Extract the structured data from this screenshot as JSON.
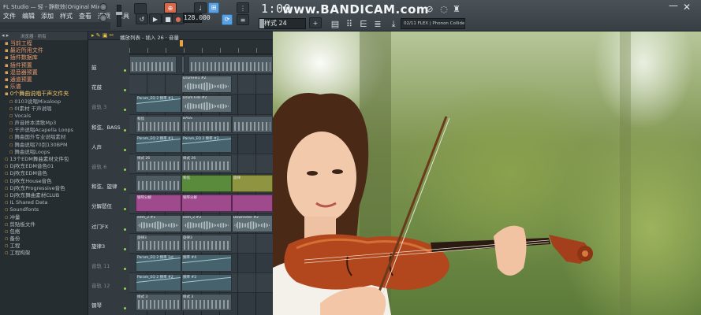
{
  "window": {
    "title": "FL Studio — 轻 - 静默效(Original Mix)"
  },
  "menu": [
    "文件",
    "编辑",
    "添加",
    "样式",
    "查看",
    "选项",
    "工具",
    "帮助"
  ],
  "transport": {
    "tempo": "128.000",
    "time": "1:00",
    "watermark": "www.BANDICAM.com",
    "pattern": "样式 24",
    "plugin": "02/11 FLEX | Phonon Collider"
  },
  "browser": {
    "header": "浏览器 · 所有",
    "items": [
      {
        "label": "当前工程",
        "kind": "top"
      },
      {
        "label": "最近所用文件",
        "kind": "top"
      },
      {
        "label": "插件数据库",
        "kind": "top"
      },
      {
        "label": "插件预置",
        "kind": "top"
      },
      {
        "label": "混音器预置",
        "kind": "top"
      },
      {
        "label": "通道预置",
        "kind": "top"
      },
      {
        "label": "乐谱",
        "kind": "top"
      },
      {
        "label": "0个舞曲说唱干声文件夹",
        "kind": "hl"
      },
      {
        "label": "0103说唱Mixaloop",
        "kind": "sub"
      },
      {
        "label": "0I素材 干声说唱",
        "kind": "sub"
      },
      {
        "label": "Vocals",
        "kind": "sub"
      },
      {
        "label": "声音样本清歌Mp3",
        "kind": "sub"
      },
      {
        "label": "干声说唱Acapella Loops",
        "kind": "sub"
      },
      {
        "label": "舞曲国外专业说唱素材",
        "kind": "sub"
      },
      {
        "label": "舞曲说唱70到130BPM",
        "kind": "sub"
      },
      {
        "label": "舞曲说唱Loops",
        "kind": "sub"
      },
      {
        "label": "13个EDM舞曲素材文件包",
        "kind": "lvl0"
      },
      {
        "label": "Dj吹东EDM音色01",
        "kind": "lvl0"
      },
      {
        "label": "Dj吹东EDM音色",
        "kind": "lvl0"
      },
      {
        "label": "Dj吹东House音色",
        "kind": "lvl0"
      },
      {
        "label": "Dj吹东Progressive音色",
        "kind": "lvl0"
      },
      {
        "label": "Dj吹东舞曲素材CLUB",
        "kind": "lvl0"
      },
      {
        "label": "IL Shared Data",
        "kind": "lvl0"
      },
      {
        "label": "Soundfonts",
        "kind": "lvl0"
      },
      {
        "label": "冲量",
        "kind": "lvl0"
      },
      {
        "label": "剪贴板文件",
        "kind": "lvl0"
      },
      {
        "label": "包络",
        "kind": "lvl0"
      },
      {
        "label": "备份",
        "kind": "lvl0"
      },
      {
        "label": "工程",
        "kind": "lvl0"
      },
      {
        "label": "工程构架",
        "kind": "lvl0"
      }
    ]
  },
  "playlist": {
    "header": "播放列表 - 插入 26 · 音量",
    "tracks": [
      {
        "label": "鼓",
        "dim": false
      },
      {
        "label": "花鼓",
        "dim": false
      },
      {
        "label": "音轨 3",
        "dim": true
      },
      {
        "label": "和弦、BASS",
        "dim": false
      },
      {
        "label": "人声",
        "dim": false
      },
      {
        "label": "音轨 6",
        "dim": true
      },
      {
        "label": "和弦、旋律",
        "dim": false
      },
      {
        "label": "分解琶伍",
        "dim": false
      },
      {
        "label": "过门FX",
        "dim": false
      },
      {
        "label": "旋律3",
        "dim": false
      },
      {
        "label": "音轨 11",
        "dim": true
      },
      {
        "label": "音轨 12",
        "dim": true
      },
      {
        "label": "钢琴",
        "dim": false
      }
    ],
    "clips": [
      {
        "row": 0,
        "start": 0,
        "len": 60,
        "kind": "pat",
        "label": ""
      },
      {
        "row": 0,
        "start": 66,
        "len": 4,
        "kind": "pat",
        "label": ""
      },
      {
        "row": 0,
        "start": 75,
        "len": 107,
        "kind": "pat",
        "label": ""
      },
      {
        "row": 1,
        "start": 66,
        "len": 64,
        "kind": "aud",
        "label": "DrumFill1 #2"
      },
      {
        "row": 2,
        "start": 8,
        "len": 58,
        "kind": "auto",
        "label": "Param_EQ 2 频率 #1"
      },
      {
        "row": 2,
        "start": 66,
        "len": 64,
        "kind": "aud",
        "label": "Drum Fills #2"
      },
      {
        "row": 3,
        "start": 8,
        "len": 58,
        "kind": "pat",
        "label": "和弦"
      },
      {
        "row": 3,
        "start": 66,
        "len": 64,
        "kind": "pat",
        "label": "BASS"
      },
      {
        "row": 3,
        "start": 130,
        "len": 52,
        "kind": "pat",
        "label": ""
      },
      {
        "row": 4,
        "start": 8,
        "len": 58,
        "kind": "auto",
        "label": "Param_EQ 2 频率 #1"
      },
      {
        "row": 4,
        "start": 66,
        "len": 64,
        "kind": "auto",
        "label": "Param_EQ 2 频率 #2"
      },
      {
        "row": 5,
        "start": 8,
        "len": 58,
        "kind": "pat",
        "label": "样式 26"
      },
      {
        "row": 5,
        "start": 66,
        "len": 64,
        "kind": "pat",
        "label": "样式 26"
      },
      {
        "row": 6,
        "start": 8,
        "len": 58,
        "kind": "pat",
        "label": ""
      },
      {
        "row": 6,
        "start": 66,
        "len": 64,
        "kind": "green",
        "label": "和弦"
      },
      {
        "row": 6,
        "start": 130,
        "len": 52,
        "kind": "yellow",
        "label": "旋律"
      },
      {
        "row": 7,
        "start": 8,
        "len": 58,
        "kind": "pink",
        "label": "钢琴分解"
      },
      {
        "row": 7,
        "start": 66,
        "len": 64,
        "kind": "pink",
        "label": "钢琴分解"
      },
      {
        "row": 7,
        "start": 130,
        "len": 52,
        "kind": "pink",
        "label": ""
      },
      {
        "row": 8,
        "start": 8,
        "len": 58,
        "kind": "aud",
        "label": "edm_2 #1"
      },
      {
        "row": 8,
        "start": 66,
        "len": 64,
        "kind": "aud",
        "label": "edm_2 #2"
      },
      {
        "row": 8,
        "start": 130,
        "len": 52,
        "kind": "aud",
        "label": "DownFilter #2"
      },
      {
        "row": 9,
        "start": 8,
        "len": 58,
        "kind": "pat",
        "label": "旋律3"
      },
      {
        "row": 9,
        "start": 66,
        "len": 64,
        "kind": "pat",
        "label": "旋律3"
      },
      {
        "row": 10,
        "start": 8,
        "len": 58,
        "kind": "auto",
        "label": "Param_EQ 2 频率 1st"
      },
      {
        "row": 10,
        "start": 66,
        "len": 64,
        "kind": "auto",
        "label": "频率 #4"
      },
      {
        "row": 11,
        "start": 8,
        "len": 58,
        "kind": "auto",
        "label": "Param_EQ 2 频率 #2"
      },
      {
        "row": 11,
        "start": 66,
        "len": 64,
        "kind": "auto",
        "label": "频率 #2"
      },
      {
        "row": 12,
        "start": 8,
        "len": 58,
        "kind": "pat",
        "label": "样式 3"
      },
      {
        "row": 12,
        "start": 66,
        "len": 64,
        "kind": "pat",
        "label": "样式 3"
      }
    ]
  }
}
